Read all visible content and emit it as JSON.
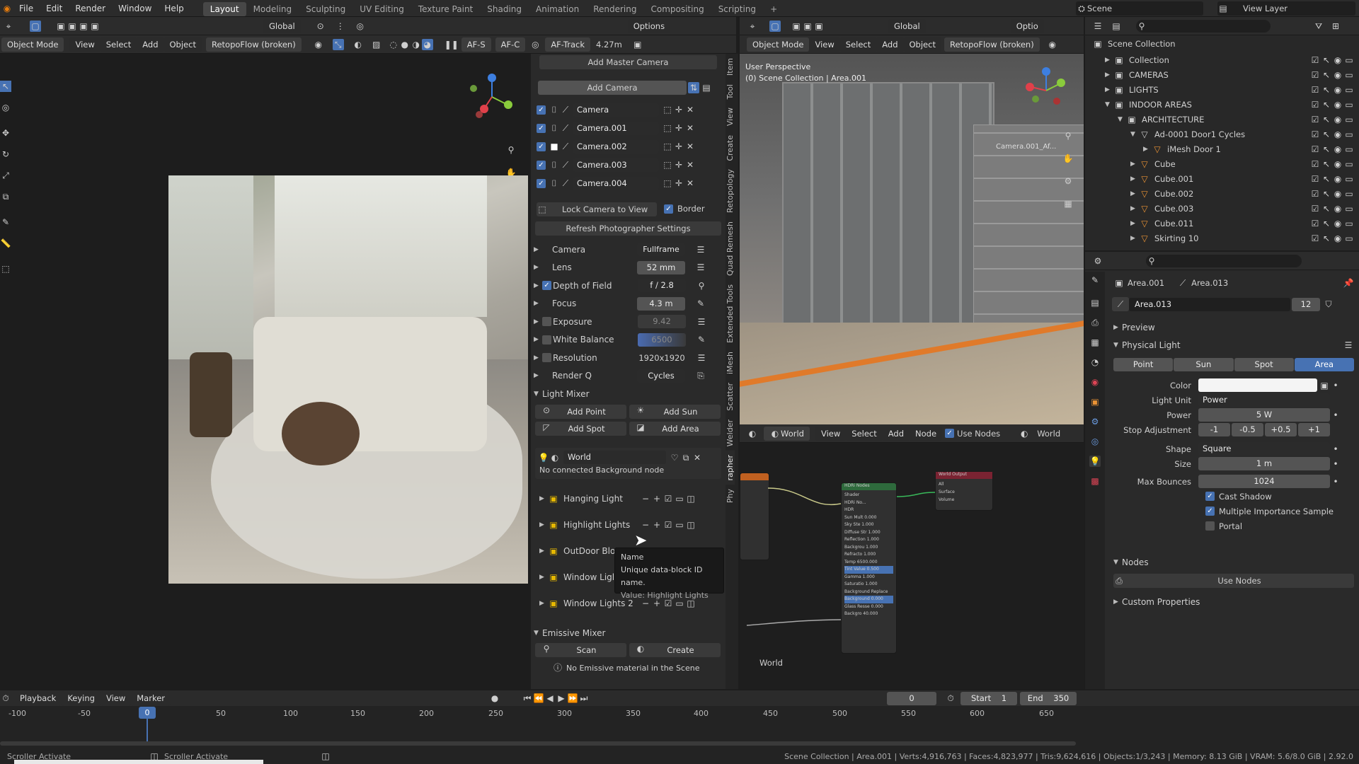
{
  "menus": [
    "File",
    "Edit",
    "Render",
    "Window",
    "Help"
  ],
  "workspaces": [
    "Layout",
    "Modeling",
    "Sculpting",
    "UV Editing",
    "Texture Paint",
    "Shading",
    "Animation",
    "Rendering",
    "Compositing",
    "Scripting"
  ],
  "workspace_add": "+",
  "scene": "Scene",
  "view_layer": "View Layer",
  "left_header": {
    "transform": "Global",
    "options": "Options",
    "mode": "Object Mode",
    "view": "View",
    "select": "Select",
    "add": "Add",
    "object": "Object",
    "retopo": "RetopoFlow (broken)",
    "af_s": "AF-S",
    "af_c": "AF-C",
    "af_track": "AF-Track",
    "dist": "4.27m"
  },
  "photographer": {
    "add_master": "Add Master Camera",
    "add_camera": "Add Camera",
    "cameras": [
      "Camera",
      "Camera.001",
      "Camera.002",
      "Camera.003",
      "Camera.004"
    ],
    "lock": "Lock Camera to View",
    "border": "Border",
    "refresh": "Refresh Photographer Settings",
    "rows": [
      {
        "label": "Camera",
        "value": "Fullframe",
        "chk": false,
        "dd": true
      },
      {
        "label": "Lens",
        "value": "52 mm",
        "chk": false
      },
      {
        "label": "Depth of Field",
        "value": "f / 2.8",
        "chk": true,
        "on": true,
        "dd": true
      },
      {
        "label": "Focus",
        "value": "4.3 m",
        "chk": false
      },
      {
        "label": "Exposure",
        "value": "9.42",
        "chk": true,
        "on": false,
        "dim": true
      },
      {
        "label": "White Balance",
        "value": "6500",
        "chk": true,
        "on": false,
        "dim": true,
        "wb": true
      },
      {
        "label": "Resolution",
        "value": "1920x1920",
        "chk": true,
        "on": false,
        "plain": true
      },
      {
        "label": "Render Q",
        "value": "Cycles",
        "chk": false,
        "dd": true
      }
    ],
    "light_mixer": "Light Mixer",
    "add_point": "Add Point",
    "add_sun": "Add Sun",
    "add_spot": "Add Spot",
    "add_area": "Add Area",
    "world": "World",
    "no_bg": "No connected Background node",
    "lights": [
      "Hanging Light",
      "Highlight Lights",
      "OutDoor Blo",
      "Window Ligl",
      "Window Lights 2"
    ],
    "emissive": "Emissive Mixer",
    "scan": "Scan",
    "create": "Create",
    "no_emissive": "No Emissive material in the Scene",
    "tooltip": {
      "name": "Name",
      "desc": "Unique data-block ID name.",
      "value": "Value: Highlight Lights"
    }
  },
  "vtabs": [
    "Item",
    "Tool",
    "View",
    "Create",
    "Retopology",
    "Quad Remesh",
    "Extended Tools",
    "iMesh",
    "Scatter",
    "Welder",
    "rapher",
    "Phy"
  ],
  "right_viewport": {
    "mode": "Object Mode",
    "view": "View",
    "select": "Select",
    "add": "Add",
    "object": "Object",
    "retopo": "RetopoFlow (broken)",
    "global": "Global",
    "options": "Optio",
    "title": "User Perspective",
    "subtitle": "(0) Scene Collection | Area.001",
    "cam_label": "Camera.001_Af..."
  },
  "node_editor": {
    "world": "World",
    "view": "View",
    "select": "Select",
    "add": "Add",
    "node": "Node",
    "use_nodes": "Use Nodes",
    "world_right": "World",
    "label": "World",
    "hdr_title": "HDRi Nodes",
    "out_title": "World Output",
    "out_items": [
      "All",
      "Surface",
      "Volume"
    ],
    "hdr_items": [
      "Shader",
      "HDRi No...",
      "HDR",
      "Sun Mult 0.000",
      "Sky Ste 1.000",
      "Diffuse Str 1.000",
      "Reflection 1.000",
      "Backgrou 1.000",
      "Refracto 1.000",
      "Temp 6500.000",
      "Tint Value 0.500",
      "Gamma 1.000",
      "Saturatio 1.000",
      "Background Replace",
      "Background 0.000",
      "Glass Resse 0.000",
      "Backgro 40.000"
    ]
  },
  "outliner": {
    "root": "Scene Collection",
    "items": [
      {
        "name": "Collection",
        "depth": 1
      },
      {
        "name": "CAMERAS",
        "depth": 1
      },
      {
        "name": "LIGHTS",
        "depth": 1
      },
      {
        "name": "INDOOR AREAS",
        "depth": 1
      },
      {
        "name": "ARCHITECTURE",
        "depth": 2
      },
      {
        "name": "Ad-0001 Door1 Cycles",
        "depth": 3
      },
      {
        "name": "iMesh Door 1",
        "depth": 4
      },
      {
        "name": "Cube",
        "depth": 3
      },
      {
        "name": "Cube.001",
        "depth": 3
      },
      {
        "name": "Cube.002",
        "depth": 3
      },
      {
        "name": "Cube.003",
        "depth": 3
      },
      {
        "name": "Cube.011",
        "depth": 3
      },
      {
        "name": "Skirting 10",
        "depth": 3
      }
    ]
  },
  "properties": {
    "obj": "Area.001",
    "data": "Area.013",
    "datablock": "Area.013",
    "users": "12",
    "preview": "Preview",
    "physical": "Physical Light",
    "types": [
      "Point",
      "Sun",
      "Spot",
      "Area"
    ],
    "active_type": "Area",
    "color_label": "Color",
    "unit_label": "Light Unit",
    "unit": "Power",
    "power_label": "Power",
    "power": "5 W",
    "stop_label": "Stop Adjustment",
    "stops": [
      "-1",
      "-0.5",
      "+0.5",
      "+1"
    ],
    "shape_label": "Shape",
    "shape": "Square",
    "size_label": "Size",
    "size": "1 m",
    "bounces_label": "Max Bounces",
    "bounces": "1024",
    "cast_shadow": "Cast Shadow",
    "mis": "Multiple Importance Sample",
    "portal": "Portal",
    "nodes": "Nodes",
    "use_nodes": "Use Nodes",
    "custom": "Custom Properties"
  },
  "timeline": {
    "playback": "Playback",
    "keying": "Keying",
    "view": "View",
    "marker": "Marker",
    "frame": "0",
    "start_label": "Start",
    "start": "1",
    "end_label": "End",
    "end": "350",
    "current": "0",
    "ticks": [
      "-100",
      "-50",
      "50",
      "100",
      "150",
      "200",
      "250",
      "300",
      "350",
      "400",
      "450",
      "500",
      "550",
      "600",
      "650"
    ]
  },
  "status": {
    "left1": "Scroller Activate",
    "left2": "Scroller Activate",
    "right": "Scene Collection | Area.001 | Verts:4,916,763 | Faces:4,823,977 | Tris:9,624,616 | Objects:1/3,243 | Memory: 8.13 GiB | VRAM: 5.6/8.0 GiB | 2.92.0"
  },
  "colors": {
    "accent": "#4772b3",
    "bg": "#1d1d1d",
    "panel": "#2a2a2a",
    "active_type": "#4772b3"
  }
}
